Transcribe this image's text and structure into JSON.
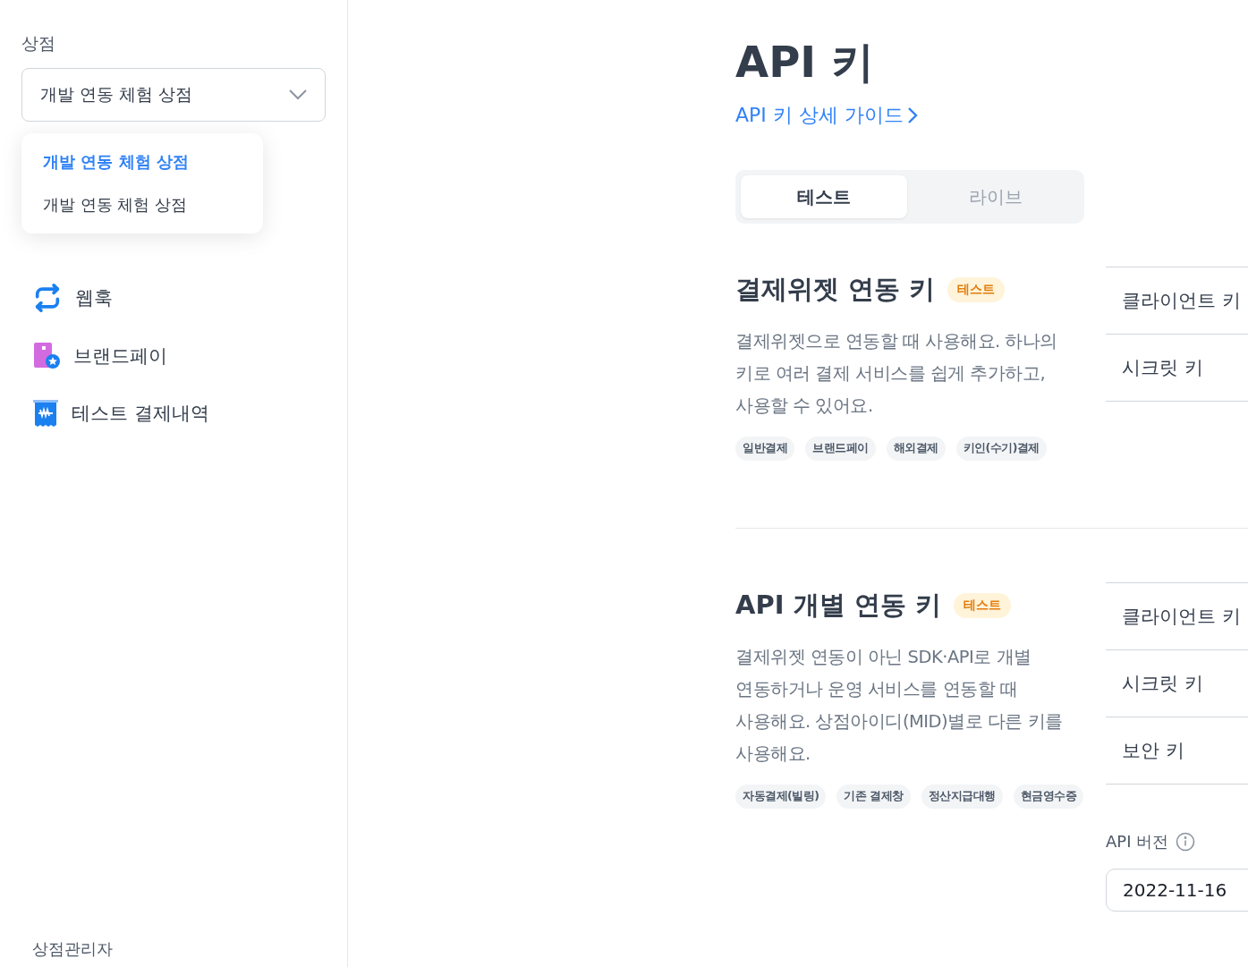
{
  "sidebar": {
    "store_label": "상점",
    "store_select": {
      "value": "개발 연동 체험 상점",
      "expanded": true
    },
    "dropdown_options": [
      {
        "label": "개발 연동 체험 상점",
        "selected": true
      },
      {
        "label": "개발 연동 체험 상점",
        "selected": false
      }
    ],
    "nav_items": [
      {
        "kind": "webhook",
        "label": "웹훅"
      },
      {
        "kind": "brandpay",
        "label": "브랜드페이"
      },
      {
        "kind": "receipt",
        "label": "테스트 결제내역"
      }
    ],
    "footer": "상점관리자"
  },
  "main": {
    "title": "API 키",
    "guide_link": "API 키 상세 가이드",
    "tabs": [
      {
        "label": "테스트",
        "selected": true
      },
      {
        "label": "라이브",
        "selected": false
      }
    ],
    "sections": [
      {
        "title": "결제위젯 연동 키",
        "badge": "테스트",
        "description": "결제위젯으로 연동할 때 사용해요. 하나의 키로 여러 결제 서비스를 쉽게 추가하고, 사용할 수 있어요.",
        "tags": [
          "일반결제",
          "브랜드페이",
          "해외결제",
          "키인(수기)결제"
        ],
        "keys": [
          "클라이언트 키",
          "시크릿 키"
        ]
      },
      {
        "title": "API 개별 연동 키",
        "badge": "테스트",
        "description": "결제위젯 연동이 아닌 SDK·API로 개별 연동하거나 운영 서비스를 연동할 때 사용해요. 상점아이디(MID)별로 다른 키를 사용해요.",
        "tags": [
          "자동결제(빌링)",
          "기존 결제창",
          "정산지급대행",
          "현금영수증"
        ],
        "keys": [
          "클라이언트 키",
          "시크릿 키",
          "보안 키"
        ],
        "api_version": {
          "label": "API 버전",
          "value": "2022-11-16"
        }
      }
    ]
  }
}
